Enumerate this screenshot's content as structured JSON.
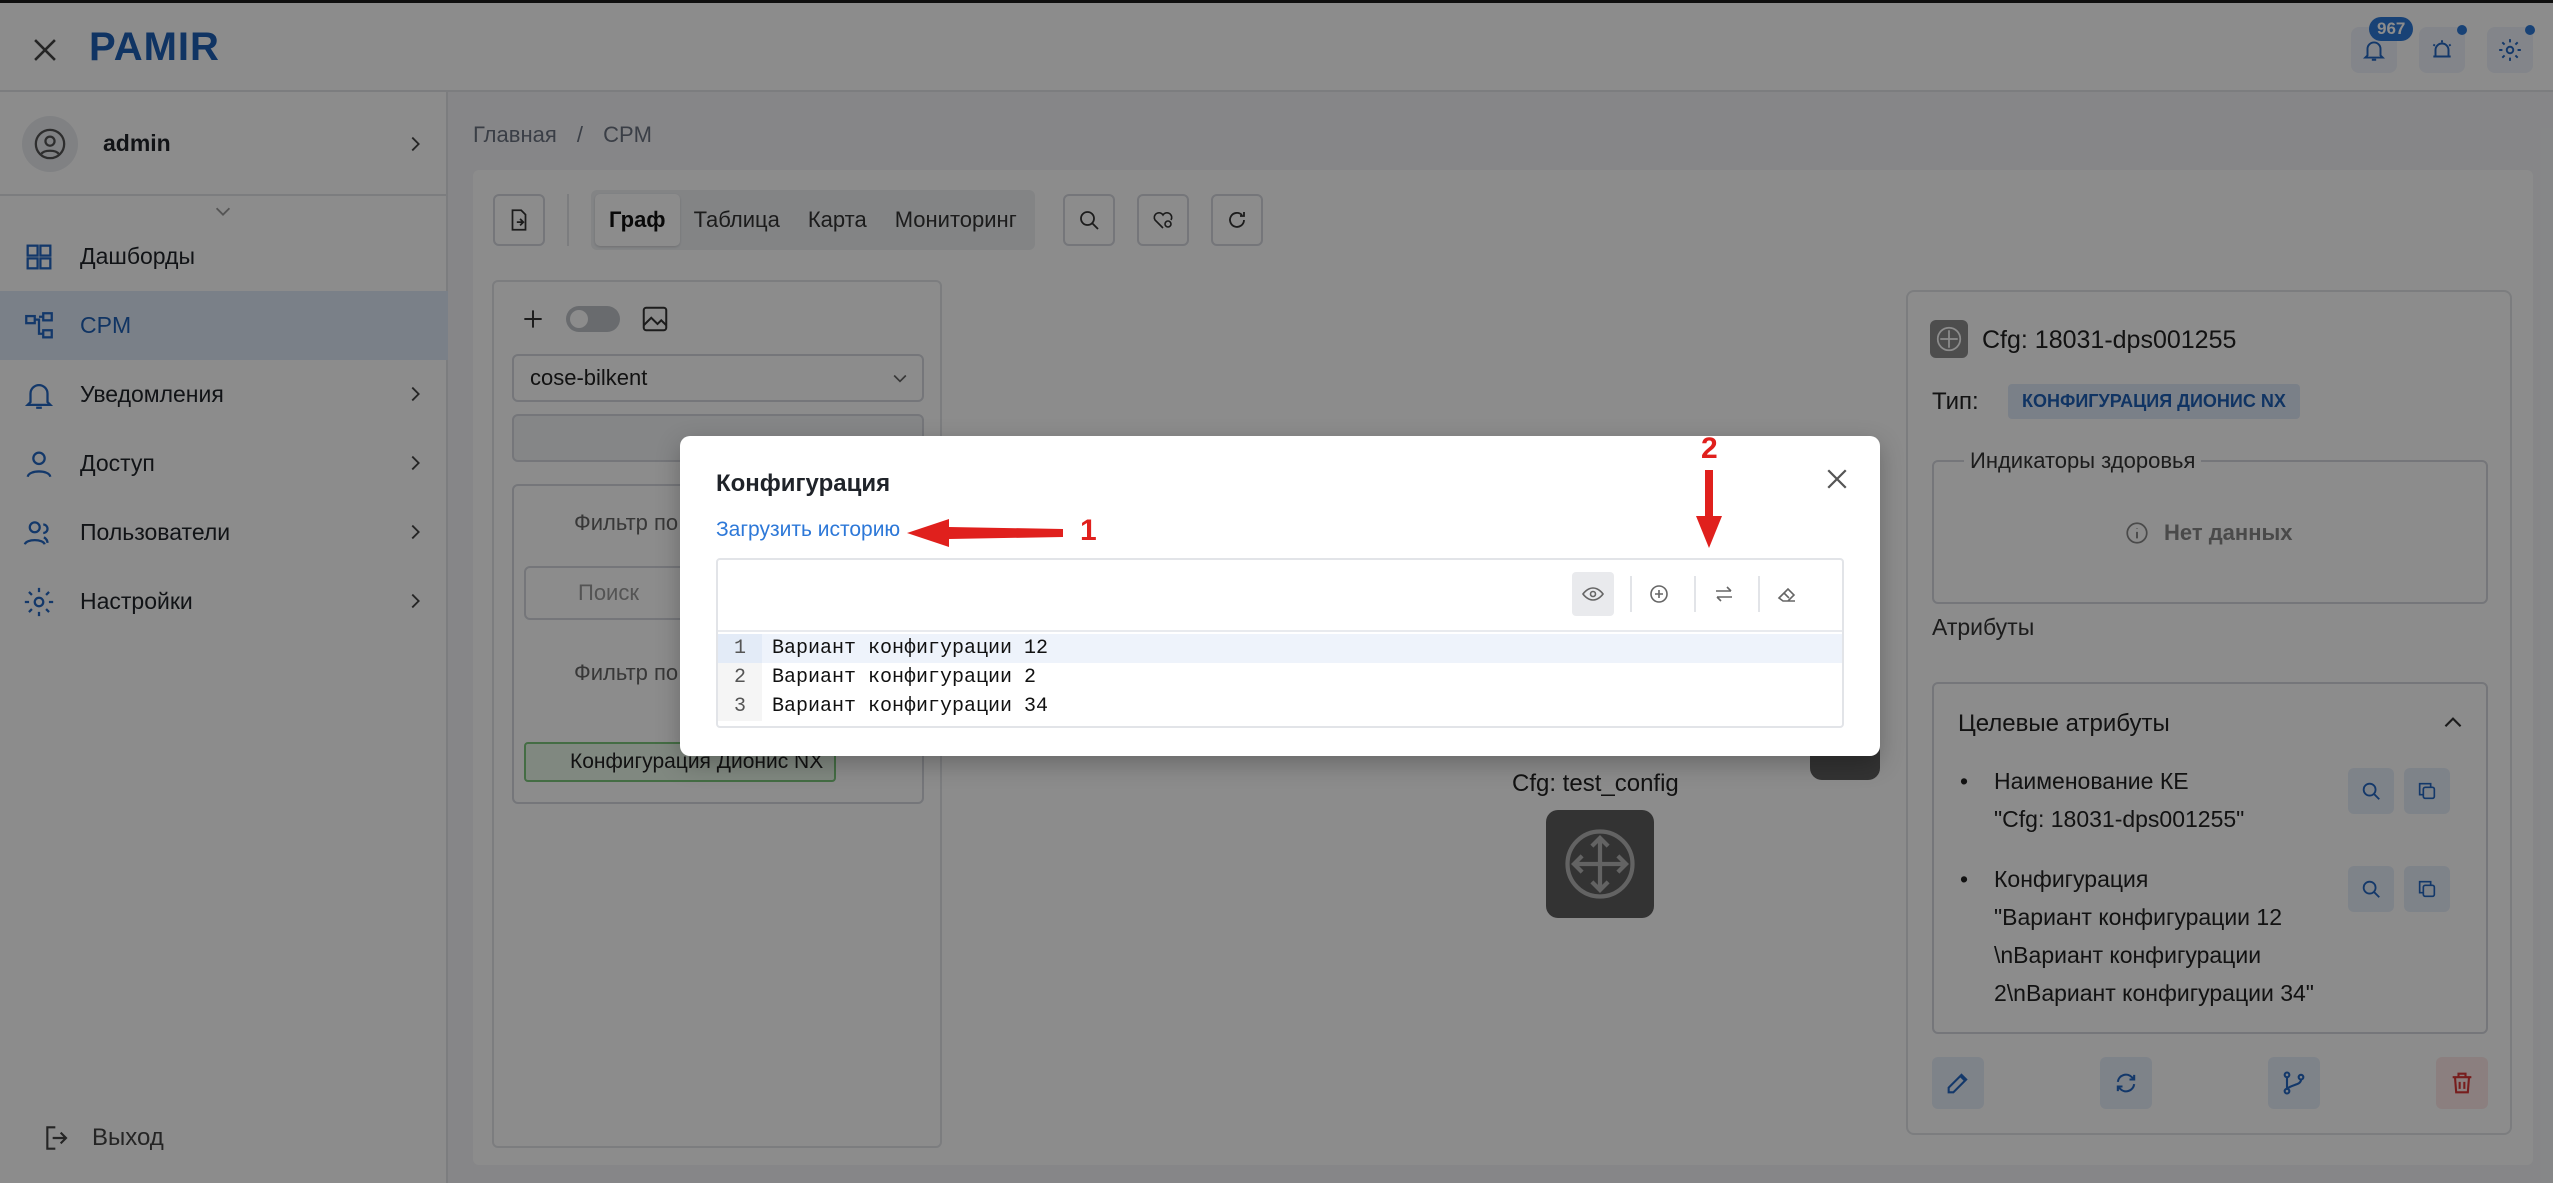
{
  "app": {
    "title": "PAMIR"
  },
  "header": {
    "notifications_count": "967"
  },
  "sidebar": {
    "user": "admin",
    "items": [
      {
        "label": "Дашборды",
        "icon": "dashboard-icon",
        "active": false,
        "chevron": false
      },
      {
        "label": "CPM",
        "icon": "graph-icon",
        "active": true,
        "chevron": false
      },
      {
        "label": "Уведомления",
        "icon": "bell-icon",
        "active": false,
        "chevron": true
      },
      {
        "label": "Доступ",
        "icon": "user-icon",
        "active": false,
        "chevron": true
      },
      {
        "label": "Пользователи",
        "icon": "users-icon",
        "active": false,
        "chevron": true
      },
      {
        "label": "Настройки",
        "icon": "gear-icon",
        "active": false,
        "chevron": true
      }
    ],
    "logout": "Выход"
  },
  "breadcrumb": {
    "home": "Главная",
    "sep": "/",
    "current": "CPM"
  },
  "toolbar": {
    "views": [
      "Граф",
      "Таблица",
      "Карта",
      "Мониторинг"
    ],
    "active_view": "Граф"
  },
  "left_panel": {
    "layout": "cose-bilkent",
    "filter1": "Фильтр по",
    "search_placeholder": "Поиск",
    "filter2": "Фильтр по",
    "tag": "Конфигурация Дионис NX"
  },
  "graph": {
    "node_label": "Cfg: test_config"
  },
  "details": {
    "title": "Cfg: 18031-dps001255",
    "type_label": "Тип:",
    "type_value": "КОНФИГУРАЦИЯ ДИОНИС NX",
    "health_title": "Индикаторы здоровья",
    "health_empty": "Нет данных",
    "attributes": "Атрибуты",
    "target_title": "Целевые атрибуты",
    "target_items": [
      {
        "name": "Наименование КЕ",
        "value": "\"Cfg: 18031-dps001255\""
      },
      {
        "name": "Конфигурация",
        "value": "\"Вариант конфигурации 12 \\nВариант конфигурации 2\\nВариант конфигурации 34\""
      }
    ]
  },
  "modal": {
    "title": "Конфигурация",
    "history_link": "Загрузить историю",
    "lines": [
      {
        "num": "1",
        "text": "Вариант конфигурации 12"
      },
      {
        "num": "2",
        "text": "Вариант конфигурации 2"
      },
      {
        "num": "3",
        "text": "Вариант конфигурации 34"
      }
    ]
  },
  "annotations": {
    "first": "1",
    "second": "2",
    "color": "#e0201d"
  },
  "colors": {
    "brand": "#1e5fb4",
    "link": "#2d78d8",
    "danger": "#d93636"
  }
}
